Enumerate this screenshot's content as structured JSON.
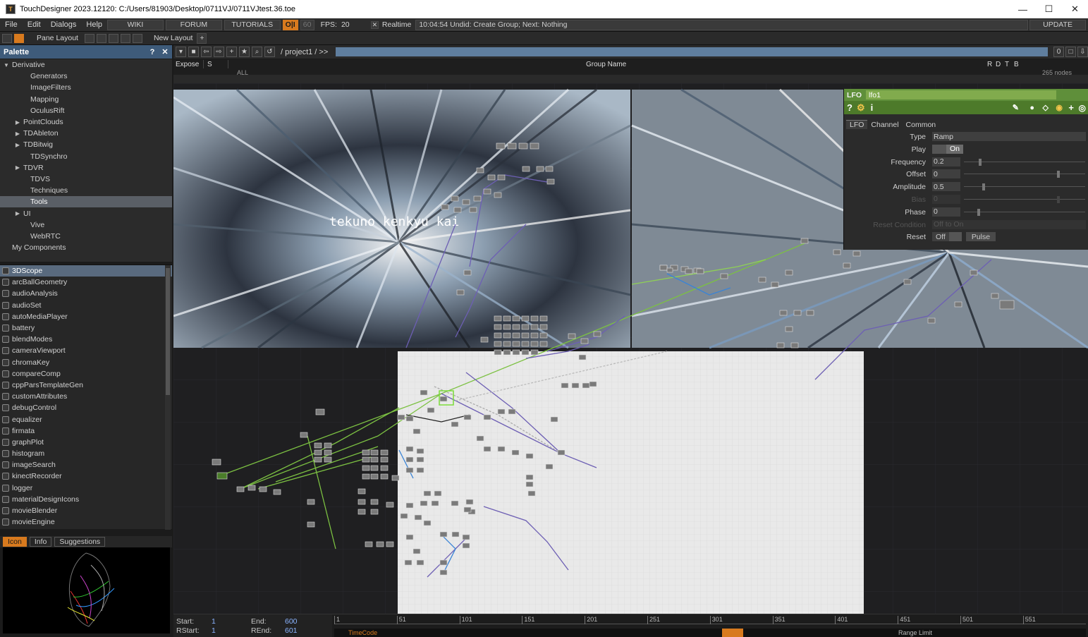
{
  "window": {
    "title": "TouchDesigner 2023.12120: C:/Users/81903/Desktop/0711VJ/0711VJtest.36.toe",
    "controls": [
      "—",
      "☐",
      "✕"
    ]
  },
  "menu": {
    "items": [
      "File",
      "Edit",
      "Dialogs",
      "Help"
    ],
    "buttons": [
      "WIKI",
      "FORUM",
      "TUTORIALS"
    ],
    "oi": "O|I",
    "fps_target": "60",
    "fps_label": "FPS:",
    "fps_value": "20",
    "realtime_check": "✕",
    "realtime_label": "Realtime",
    "status": "10:04:54 Undid: Create Group; Next: Nothing",
    "update": "UPDATE"
  },
  "toolbar": {
    "pane_layout": "Pane Layout",
    "new_layout": "New Layout",
    "plus": "+"
  },
  "palette": {
    "title": "Palette",
    "help": "?",
    "close": "✕",
    "tree": [
      {
        "label": "Derivative",
        "indent": 0,
        "arrow": "▼"
      },
      {
        "label": "Generators",
        "indent": 2,
        "arrow": ""
      },
      {
        "label": "ImageFilters",
        "indent": 2,
        "arrow": ""
      },
      {
        "label": "Mapping",
        "indent": 2,
        "arrow": ""
      },
      {
        "label": "OculusRift",
        "indent": 2,
        "arrow": ""
      },
      {
        "label": "PointClouds",
        "indent": 1,
        "arrow": "▶"
      },
      {
        "label": "TDAbleton",
        "indent": 1,
        "arrow": "▶"
      },
      {
        "label": "TDBitwig",
        "indent": 1,
        "arrow": "▶"
      },
      {
        "label": "TDSynchro",
        "indent": 2,
        "arrow": ""
      },
      {
        "label": "TDVR",
        "indent": 1,
        "arrow": "▶"
      },
      {
        "label": "TDVS",
        "indent": 2,
        "arrow": ""
      },
      {
        "label": "Techniques",
        "indent": 2,
        "arrow": ""
      },
      {
        "label": "Tools",
        "indent": 2,
        "arrow": "",
        "selected": true
      },
      {
        "label": "UI",
        "indent": 1,
        "arrow": "▶"
      },
      {
        "label": "Vive",
        "indent": 2,
        "arrow": ""
      },
      {
        "label": "WebRTC",
        "indent": 2,
        "arrow": ""
      },
      {
        "label": "My Components",
        "indent": 0,
        "arrow": ""
      }
    ],
    "components": [
      "3DScope",
      "arcBallGeometry",
      "audioAnalysis",
      "audioSet",
      "autoMediaPlayer",
      "battery",
      "blendModes",
      "cameraViewport",
      "chromaKey",
      "compareComp",
      "cppParsTemplateGen",
      "customAttributes",
      "debugControl",
      "equalizer",
      "firmata",
      "graphPlot",
      "histogram",
      "imageSearch",
      "kinectRecorder",
      "logger",
      "materialDesignIcons",
      "movieBlender",
      "movieEngine"
    ],
    "preview_tabs": [
      "Icon",
      "Info",
      "Suggestions"
    ]
  },
  "network": {
    "path": "/ project1 / >>",
    "group_headers": {
      "expose": "Expose",
      "s": "S",
      "group_name": "Group Name",
      "r": "R",
      "d": "D",
      "t": "T",
      "b": "B"
    },
    "group_row": {
      "all": "ALL",
      "count": "265 nodes"
    },
    "counter": "0",
    "overlay_text": "tekuno kenkyu kai"
  },
  "params": {
    "op_type": "LFO",
    "op_name": "lfo1",
    "icons": {
      "help": "?",
      "python": "⚙",
      "info": "i"
    },
    "tabs": [
      "LFO",
      "Channel",
      "Common"
    ],
    "rows": [
      {
        "label": "Type",
        "kind": "menu",
        "value": "Ramp"
      },
      {
        "label": "Play",
        "kind": "toggle",
        "value": "On"
      },
      {
        "label": "Frequency",
        "kind": "slider",
        "value": "0.2",
        "level": 0.12
      },
      {
        "label": "Offset",
        "kind": "slider",
        "value": "0",
        "level": 0.77
      },
      {
        "label": "Amplitude",
        "kind": "slider",
        "value": "0.5",
        "level": 0.15
      },
      {
        "label": "Bias",
        "kind": "slider-dim",
        "value": "0",
        "level": 0.77
      },
      {
        "label": "Phase",
        "kind": "slider",
        "value": "0",
        "level": 0.11
      },
      {
        "label": "Reset Condition",
        "kind": "menu-dim",
        "value": "Off to On"
      },
      {
        "label": "Reset",
        "kind": "reset",
        "value": "Off",
        "pulse": "Pulse"
      }
    ]
  },
  "timeline": {
    "start_label": "Start:",
    "start": "1",
    "end_label": "End:",
    "end": "600",
    "rstart_label": "RStart:",
    "rstart": "1",
    "rend_label": "REnd:",
    "rend": "601",
    "ticks": [
      "1",
      "51",
      "101",
      "151",
      "201",
      "251",
      "301",
      "351",
      "401",
      "451",
      "501",
      "551"
    ],
    "timecode": "TimeCode",
    "range_limit": "Range Limit"
  },
  "colors": {
    "accent": "#d87a1e",
    "palette_header": "#3e5b7a",
    "lfo_header": "#5f8f3a",
    "path_bar": "#5f7e9e"
  }
}
